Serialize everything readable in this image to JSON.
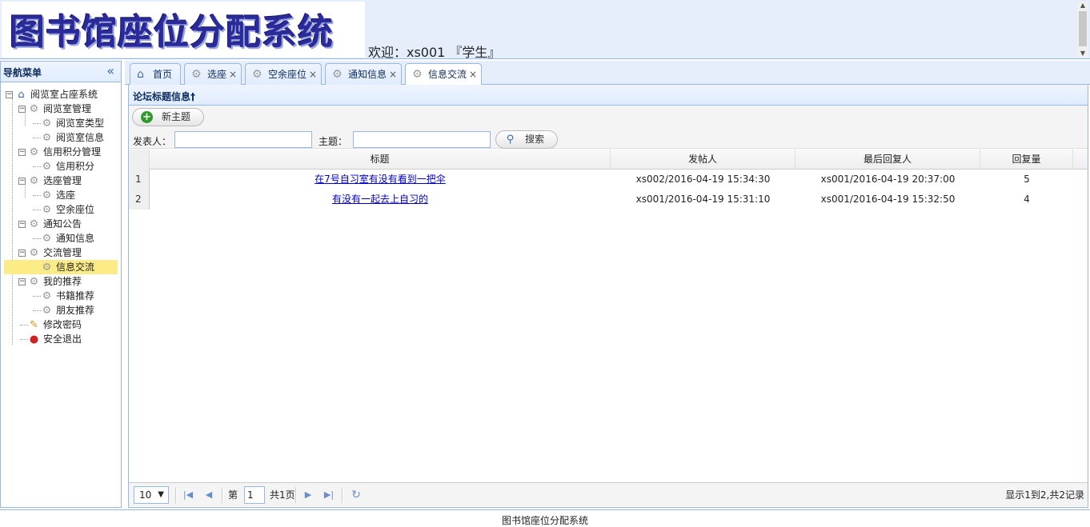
{
  "header": {
    "logo_text": "图书馆座位分配系统",
    "welcome": "欢迎：xs001 『学生』"
  },
  "nav": {
    "title": "导航菜单",
    "collapse_icon": "«",
    "tree": {
      "root": "阅览室占座系统",
      "groups": [
        {
          "label": "阅览室管理",
          "children": [
            "阅览室类型",
            "阅览室信息"
          ]
        },
        {
          "label": "信用积分管理",
          "children": [
            "信用积分"
          ]
        },
        {
          "label": "选座管理",
          "children": [
            "选座",
            "空余座位"
          ]
        },
        {
          "label": "通知公告",
          "children": [
            "通知信息"
          ]
        },
        {
          "label": "交流管理",
          "children": [
            "信息交流"
          ]
        },
        {
          "label": "我的推荐",
          "children": [
            "书籍推荐",
            "朋友推荐"
          ]
        }
      ],
      "leaves": [
        "修改密码",
        "安全退出"
      ],
      "selected": "信息交流"
    }
  },
  "tabs": [
    {
      "label": "首页",
      "icon": "home-icon",
      "closable": false
    },
    {
      "label": "选座",
      "icon": "gear-icon",
      "closable": true
    },
    {
      "label": "空余座位",
      "icon": "gear-icon",
      "closable": true
    },
    {
      "label": "通知信息",
      "icon": "gear-icon",
      "closable": true
    },
    {
      "label": "信息交流",
      "icon": "gear-icon",
      "closable": true,
      "active": true
    }
  ],
  "tab_close": "×",
  "panel": {
    "title": "论坛标题信息†",
    "new_button": "新主题",
    "poster_label": "发表人：",
    "poster_value": "",
    "subject_label": "主题：",
    "subject_value": "",
    "search_button": "搜索"
  },
  "grid": {
    "columns": [
      "标题",
      "发帖人",
      "最后回复人",
      "回复量"
    ],
    "rows": [
      {
        "num": "1",
        "title": "在7号自习室有没有看到一把伞",
        "poster": "xs002/2016-04-19 15:34:30",
        "last_reply": "xs001/2016-04-19 20:37:00",
        "replies": "5"
      },
      {
        "num": "2",
        "title": "有没有一起去上自习的",
        "poster": "xs001/2016-04-19 15:31:10",
        "last_reply": "xs001/2016-04-19 15:32:50",
        "replies": "4"
      }
    ]
  },
  "pager": {
    "page_size": "10",
    "page_prefix": "第",
    "page_value": "1",
    "page_suffix": "共1页",
    "summary": "显示1到2,共2记录"
  },
  "footer": "图书馆座位分配系统",
  "colors": {
    "border": "#95b8e7",
    "header_bg": "#e6eefb",
    "selected": "#fbec88",
    "link": "#0000cc"
  }
}
